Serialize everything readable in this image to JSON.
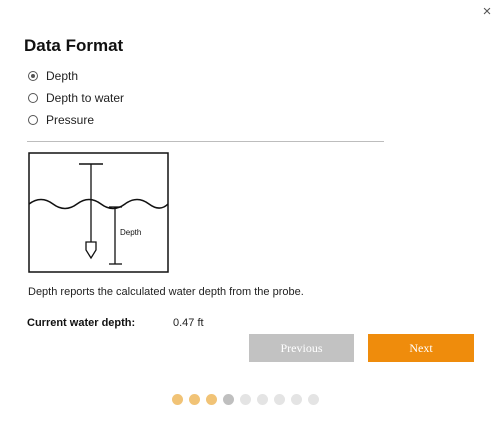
{
  "dialog": {
    "close_glyph": "×",
    "title": "Data Format",
    "options": [
      {
        "label": "Depth",
        "selected": true
      },
      {
        "label": "Depth to water",
        "selected": false
      },
      {
        "label": "Pressure",
        "selected": false
      }
    ],
    "diagram": {
      "label": "Depth"
    },
    "description": "Depth reports the calculated water depth from the probe.",
    "current": {
      "label": "Current water depth:",
      "value": "0.47 ft"
    },
    "buttons": {
      "previous": "Previous",
      "next": "Next"
    },
    "pager": {
      "total": 9,
      "current_index": 3,
      "completed": 3
    }
  },
  "colors": {
    "accent": "#ef8c0c",
    "disabled": "#c2c2c2",
    "pager_done": "#f1c376",
    "pager_current": "#bfbfbf",
    "pager_pending": "#e4e4e4"
  },
  "icons": {
    "close": "close-icon",
    "radio": "radio-icon",
    "probe": "probe-icon"
  }
}
